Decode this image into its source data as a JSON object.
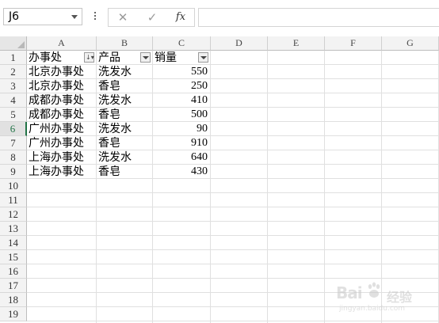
{
  "formula_bar": {
    "name_box": "J6",
    "cancel_icon": "✕",
    "enter_icon": "✓",
    "function_label": "fx",
    "formula": ""
  },
  "columns": [
    "A",
    "B",
    "C",
    "D",
    "E",
    "F",
    "G"
  ],
  "rows": [
    "1",
    "2",
    "3",
    "4",
    "5",
    "6",
    "7",
    "8",
    "9",
    "10",
    "11",
    "12",
    "13",
    "14",
    "15",
    "16",
    "17",
    "18",
    "19"
  ],
  "active_row": "6",
  "headers": {
    "office": "办事处",
    "product": "产品",
    "sales": "销量"
  },
  "data": [
    {
      "office": "北京办事处",
      "product": "洗发水",
      "sales": "550"
    },
    {
      "office": "北京办事处",
      "product": "香皂",
      "sales": "250"
    },
    {
      "office": "成都办事处",
      "product": "洗发水",
      "sales": "410"
    },
    {
      "office": "成都办事处",
      "product": "香皂",
      "sales": "500"
    },
    {
      "office": "广州办事处",
      "product": "洗发水",
      "sales": "90"
    },
    {
      "office": "广州办事处",
      "product": "香皂",
      "sales": "910"
    },
    {
      "office": "上海办事处",
      "product": "洗发水",
      "sales": "640"
    },
    {
      "office": "上海办事处",
      "product": "香皂",
      "sales": "430"
    }
  ],
  "watermark": {
    "logo": "Bai",
    "suffix": "经验",
    "url": "jingyan.baidu.com"
  },
  "colors": {
    "accent": "#217346"
  }
}
